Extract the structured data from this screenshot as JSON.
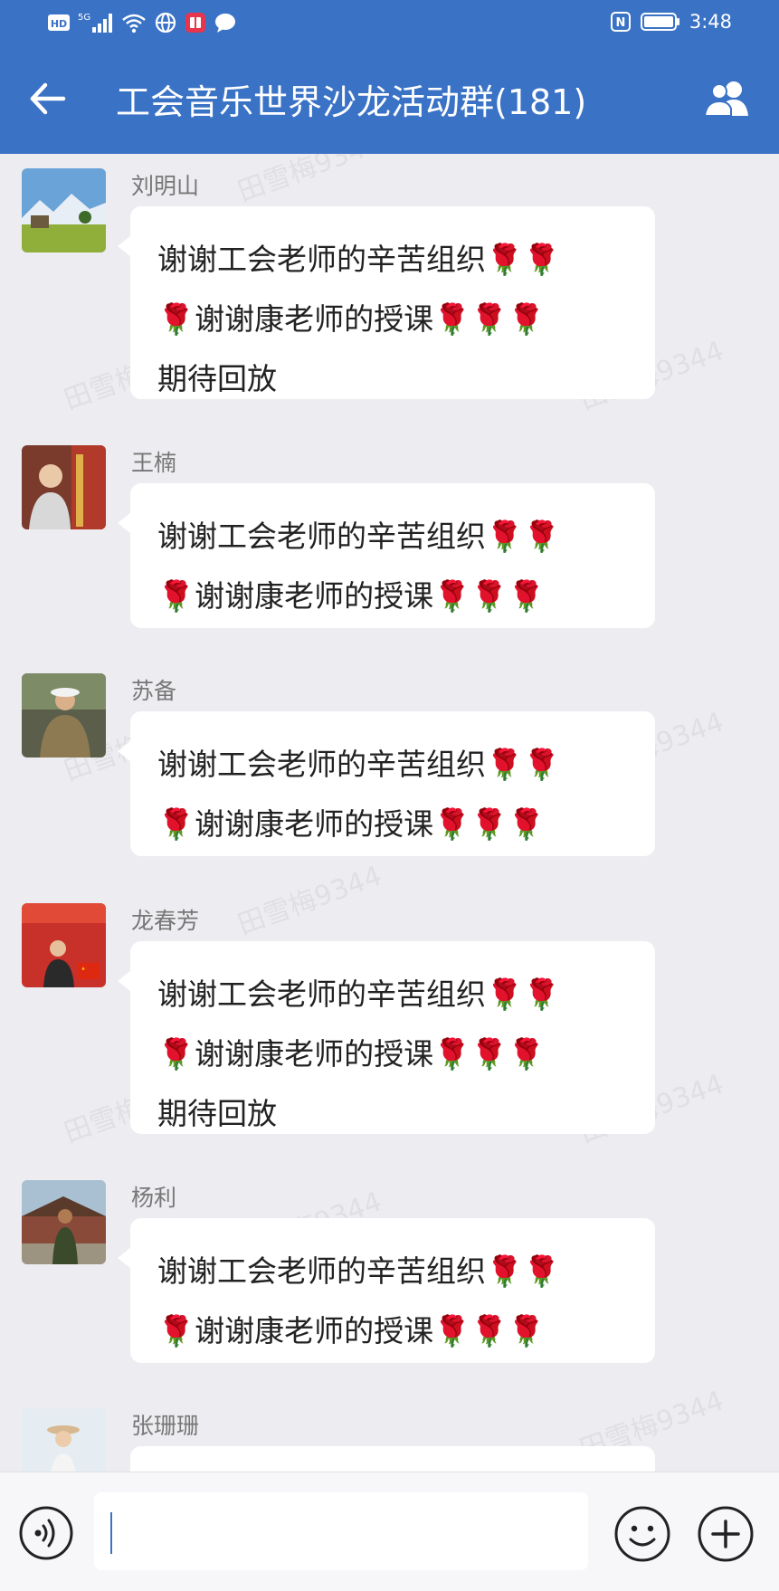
{
  "status_bar": {
    "left_badges": [
      "HD",
      "5G"
    ],
    "nfc": "N",
    "time": "3:48"
  },
  "header": {
    "title": "工会音乐世界沙龙活动群(181)",
    "back_icon": "arrow-left-icon",
    "members_icon": "group-members-icon"
  },
  "watermark": "田雪梅9344",
  "messages": [
    {
      "sender": "刘明山",
      "lines": [
        "谢谢工会老师的辛苦组织🌹🌹",
        "🌹谢谢康老师的授课🌹🌹🌹",
        "期待回放"
      ]
    },
    {
      "sender": "王楠",
      "lines": [
        "谢谢工会老师的辛苦组织🌹🌹",
        "🌹谢谢康老师的授课🌹🌹🌹"
      ]
    },
    {
      "sender": "苏备",
      "lines": [
        "谢谢工会老师的辛苦组织🌹🌹",
        "🌹谢谢康老师的授课🌹🌹🌹"
      ]
    },
    {
      "sender": "龙春芳",
      "lines": [
        "谢谢工会老师的辛苦组织🌹🌹",
        "🌹谢谢康老师的授课🌹🌹🌹",
        "期待回放"
      ]
    },
    {
      "sender": "杨利",
      "lines": [
        "谢谢工会老师的辛苦组织🌹🌹",
        "🌹谢谢康老师的授课🌹🌹🌹"
      ]
    },
    {
      "sender": "张珊珊",
      "lines": []
    }
  ],
  "input_bar": {
    "value": "",
    "placeholder": "",
    "voice_icon": "voice-icon",
    "emoji_icon": "emoji-icon",
    "plus_icon": "plus-icon"
  },
  "colors": {
    "header_bg": "#3a72c5",
    "chat_bg": "#ededf1",
    "bubble_bg": "#ffffff"
  }
}
